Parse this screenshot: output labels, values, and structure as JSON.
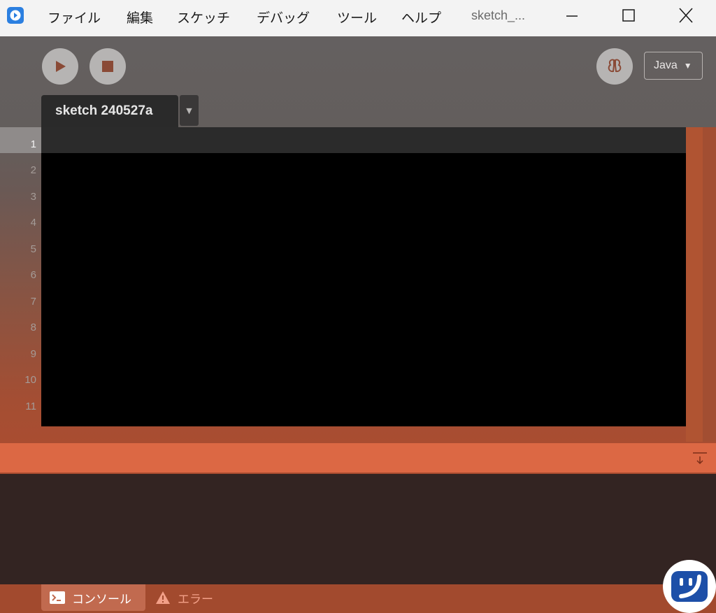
{
  "titlebar": {
    "menu": [
      "ファイル",
      "編集",
      "スケッチ",
      "デバッグ",
      "ツール",
      "ヘルプ"
    ],
    "window_title": "sketch_..."
  },
  "toolbar": {
    "run_icon": "play-icon",
    "stop_icon": "stop-icon",
    "debug_icon": "butterfly-icon",
    "mode": "Java"
  },
  "editor": {
    "tab_name": "sketch 240527a",
    "line_numbers": [
      "1",
      "2",
      "3",
      "4",
      "5",
      "6",
      "7",
      "8",
      "9",
      "10",
      "11"
    ],
    "active_line": "1"
  },
  "console": {
    "collapse_icon": "collapse-down-icon"
  },
  "status": {
    "console_label": "コンソール",
    "errors_label": "エラー",
    "console_icon": "terminal-icon",
    "errors_icon": "warning-icon"
  },
  "colors": {
    "accent": "#dc6844",
    "editor_bg": "#000000",
    "console_bg": "#332422",
    "status_bg": "#a24a2e"
  }
}
